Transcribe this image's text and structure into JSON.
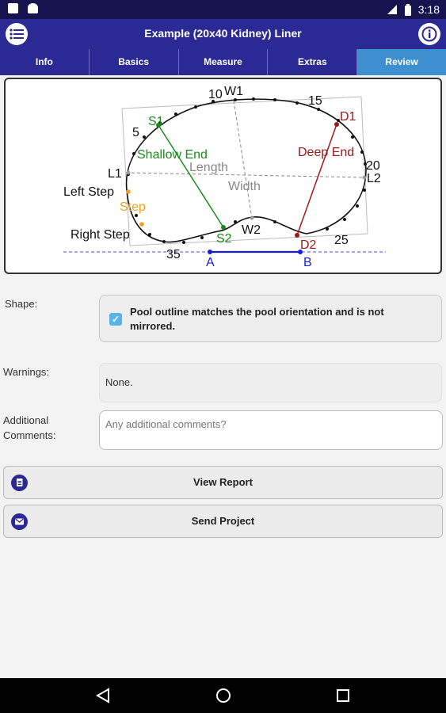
{
  "status_bar": {
    "time": "3:18"
  },
  "app_bar": {
    "title": "Example (20x40 Kidney) Liner"
  },
  "tabs": [
    {
      "label": "Info",
      "active": false
    },
    {
      "label": "Basics",
      "active": false
    },
    {
      "label": "Measure",
      "active": false
    },
    {
      "label": "Extras",
      "active": false
    },
    {
      "label": "Review",
      "active": true
    }
  ],
  "diagram": {
    "labels": {
      "w1": "W1",
      "w2": "W2",
      "n10": "10",
      "n15": "15",
      "n5": "5",
      "n20": "20",
      "n25": "25",
      "n35": "35",
      "s1": "S1",
      "s2": "S2",
      "d1": "D1",
      "d2": "D2",
      "l1": "L1",
      "l2": "L2",
      "shallow_end": "Shallow End",
      "deep_end": "Deep End",
      "length": "Length",
      "width": "Width",
      "left_step": "Left Step",
      "step": "Step",
      "right_step": "Right Step",
      "a": "A",
      "b": "B"
    },
    "colors": {
      "green": "#1a8a1a",
      "red": "#a01818",
      "blue": "#1a1add",
      "orange": "#f0a020",
      "gray": "#888888"
    }
  },
  "shape": {
    "label": "Shape:",
    "checked": true,
    "check_text": "Pool outline matches the pool orientation and is not mirrored."
  },
  "warnings": {
    "label": "Warnings:",
    "value": "None."
  },
  "comments": {
    "label": "Additional Comments:",
    "placeholder": "Any additional comments?"
  },
  "buttons": {
    "view_report": "View Report",
    "send_project": "Send Project"
  }
}
